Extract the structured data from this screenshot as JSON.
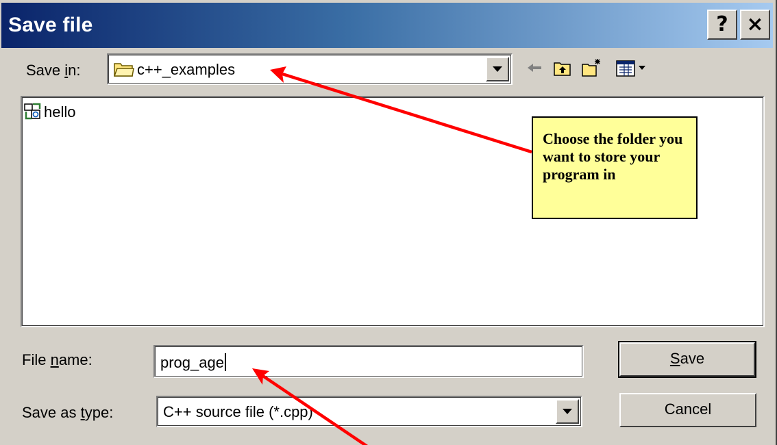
{
  "window": {
    "title": "Save file",
    "help_label": "?",
    "close_label": "×"
  },
  "save_in": {
    "label_before": "Save ",
    "label_underlined": "i",
    "label_after": "n:",
    "value": "c++_examples"
  },
  "toolbar": {
    "icons": [
      "back-arrow-icon",
      "up-folder-icon",
      "new-folder-icon",
      "views-menu-icon"
    ]
  },
  "file_list": {
    "items": [
      {
        "name": "hello",
        "icon": "cpp-file-icon"
      }
    ]
  },
  "callout": {
    "text": "Choose the folder you want to store your program in",
    "background": "#ffff99"
  },
  "file_name": {
    "label_before": "File ",
    "label_underlined": "n",
    "label_after": "ame:",
    "value": "prog_age"
  },
  "save_as_type": {
    "label_before": "Save as ",
    "label_underlined": "t",
    "label_after": "ype:",
    "value": "C++ source file (*.cpp)"
  },
  "buttons": {
    "save_underlined": "S",
    "save_rest": "ave",
    "cancel": "Cancel"
  },
  "colors": {
    "title_start": "#0a246a",
    "title_end": "#a6caf0",
    "face": "#d4d0c8",
    "arrow": "#ff0000"
  }
}
